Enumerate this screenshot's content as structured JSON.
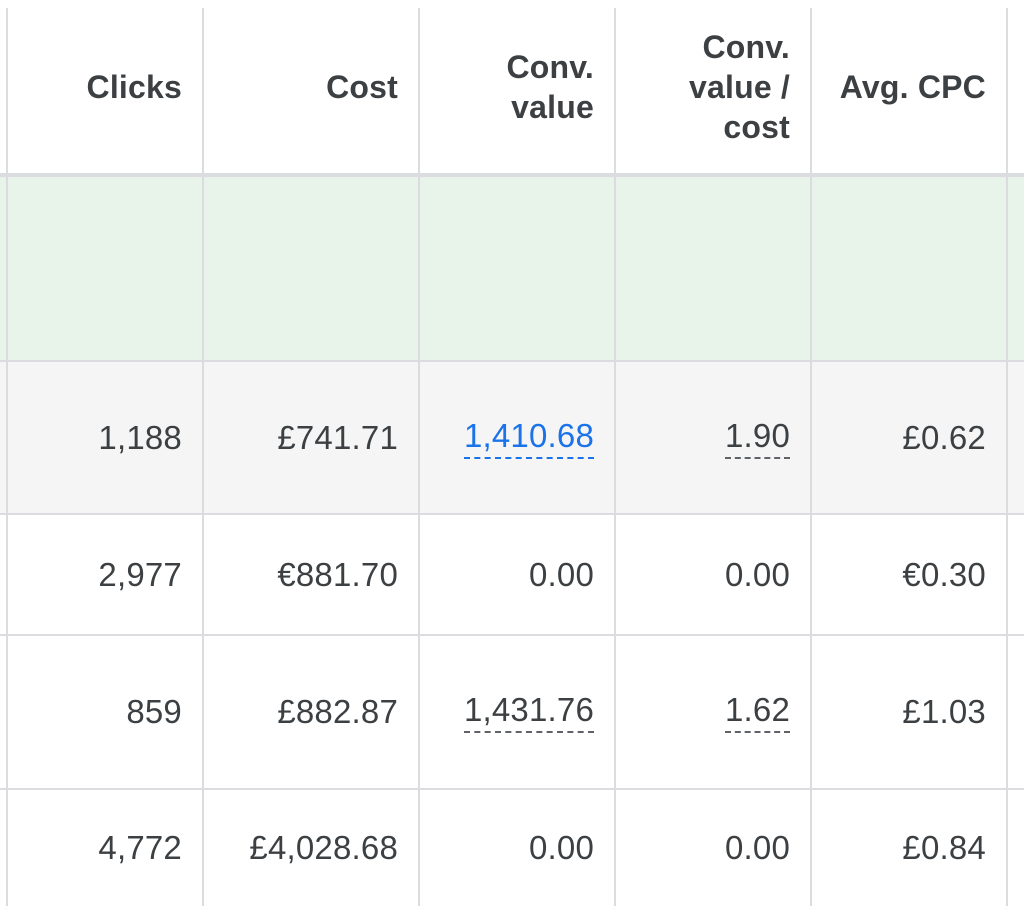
{
  "table": {
    "headers": {
      "clicks": "Clicks",
      "cost": "Cost",
      "conv_value": [
        "Conv.",
        "value"
      ],
      "conv_value_cost": [
        "Conv.",
        "value /",
        "cost"
      ],
      "avg_cpc": "Avg. CPC"
    },
    "rows": [
      {
        "clicks": "1,188",
        "cost": "£741.71",
        "conv_value": "1,410.68",
        "conv_value_cost": "1.90",
        "avg_cpc": "£0.62"
      },
      {
        "clicks": "2,977",
        "cost": "€881.70",
        "conv_value": "0.00",
        "conv_value_cost": "0.00",
        "avg_cpc": "€0.30"
      },
      {
        "clicks": "859",
        "cost": "£882.87",
        "conv_value": "1,431.76",
        "conv_value_cost": "1.62",
        "avg_cpc": "£1.03"
      },
      {
        "clicks": "4,772",
        "cost": "£4,028.68",
        "conv_value": "0.00",
        "conv_value_cost": "0.00",
        "avg_cpc": "£0.84"
      }
    ]
  },
  "colors": {
    "summary_row_bg": "#e8f3ea",
    "highlight_row_bg": "#f5f5f5",
    "link": "#1a73e8",
    "text": "#3c4043",
    "gridline": "#dadce0"
  }
}
